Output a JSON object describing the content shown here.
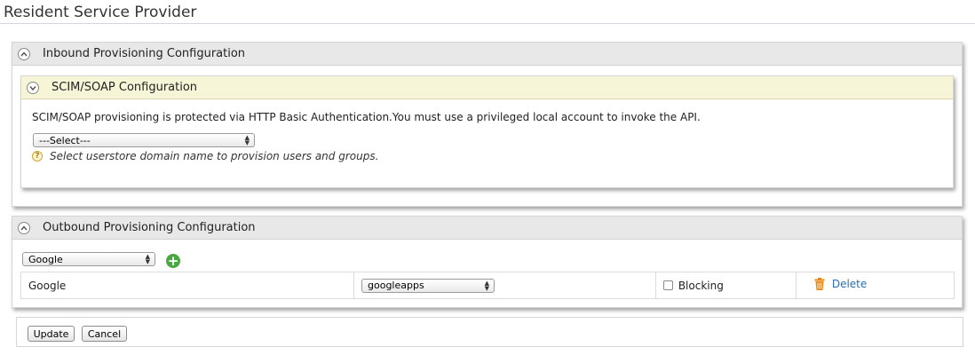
{
  "page": {
    "title": "Resident Service Provider"
  },
  "inbound": {
    "title": "Inbound Provisioning Configuration",
    "scim": {
      "title": "SCIM/SOAP Configuration",
      "description": "SCIM/SOAP provisioning is protected via HTTP Basic Authentication.You must use a privileged local account to invoke the API.",
      "userstore_select": {
        "value": "---Select---"
      },
      "hint_icon_glyph": "?",
      "hint": "Select userstore domain name to provision users and groups."
    }
  },
  "outbound": {
    "title": "Outbound Provisioning Configuration",
    "idp_select": {
      "value": "Google"
    },
    "add_icon_glyph": "+",
    "connectors": [
      {
        "name": "Google",
        "connector": "googleapps",
        "blocking_label": "Blocking",
        "blocking_checked": false,
        "delete_label": "Delete"
      }
    ]
  },
  "actions": {
    "update_label": "Update",
    "cancel_label": "Cancel"
  },
  "colors": {
    "link": "#2a6db0",
    "add_green": "#4aa843",
    "scim_header_bg": "#f7f5d7",
    "trash_orange": "#e8860f"
  }
}
